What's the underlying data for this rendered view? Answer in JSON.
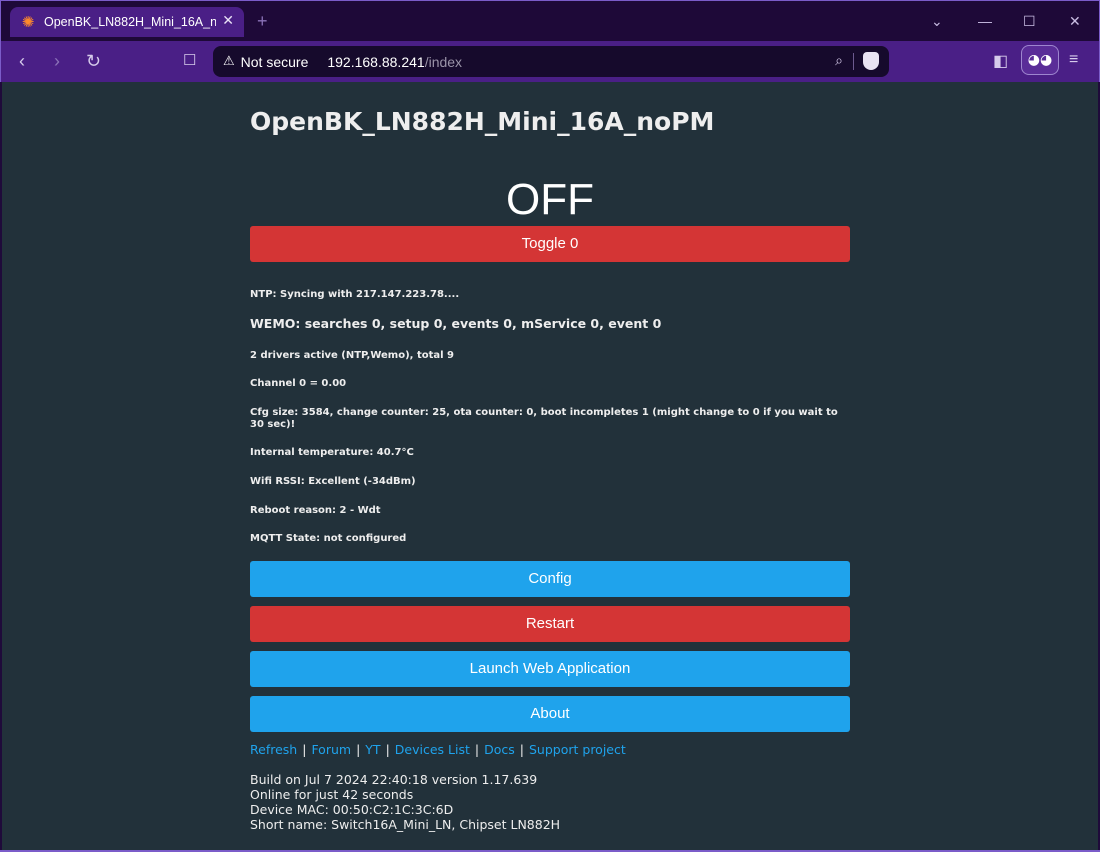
{
  "browser": {
    "tab_title": "OpenBK_LN882H_Mini_16A_noPM",
    "tab_close": "✕",
    "new_tab": "+",
    "security": "Not secure",
    "url_host": "192.168.88.241",
    "url_path": "/index"
  },
  "page": {
    "title": "OpenBK_LN882H_Mini_16A_noPM",
    "state": "OFF",
    "toggle_label": "Toggle 0",
    "info": {
      "ntp": "NTP: Syncing with 217.147.223.78....",
      "wemo": "WEMO: searches 0, setup 0, events 0, mService 0, event 0",
      "drivers": "2 drivers active (NTP,Wemo), total 9",
      "channel": "Channel 0 = 0.00",
      "cfg": "Cfg size: 3584, change counter: 25, ota counter: 0, boot incompletes 1 (might change to 0 if you wait to 30 sec)!",
      "temp": "Internal temperature: 40.7°C",
      "rssi": "Wifi RSSI: Excellent (-34dBm)",
      "reboot": "Reboot reason: 2 - Wdt",
      "mqtt": "MQTT State: not configured"
    },
    "buttons": {
      "config": "Config",
      "restart": "Restart",
      "launch": "Launch Web Application",
      "about": "About"
    },
    "links": [
      "Refresh",
      "Forum",
      "YT",
      "Devices List",
      "Docs",
      "Support project"
    ],
    "link_separator": "|",
    "footer": {
      "build": "Build on Jul 7 2024 22:40:18 version 1.17.639",
      "online": "Online for just 42 seconds",
      "mac": "Device MAC: 00:50:C2:1C:3C:6D",
      "short": "Short name: Switch16A_Mini_LN, Chipset LN882H"
    }
  },
  "colors": {
    "page_bg": "#22313a",
    "button_red": "#d43535",
    "button_blue": "#1fa3ec",
    "link": "#1fa3ec",
    "browser_frame": "#4a1f86"
  }
}
